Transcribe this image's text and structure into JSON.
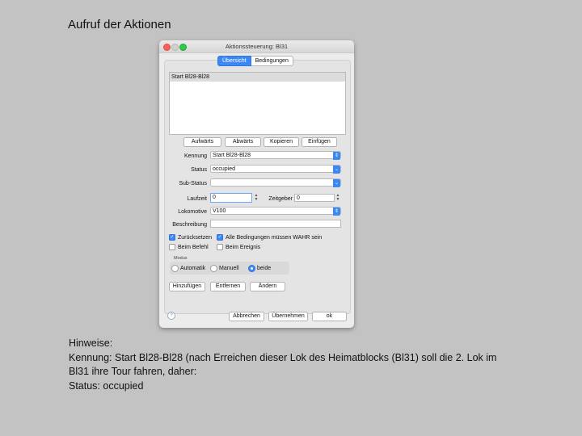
{
  "slide": {
    "title": "Aufruf der Aktionen",
    "notes": [
      "Hinweise:",
      "Kennung: Start Bl28-Bl28 (nach Erreichen dieser Lok des Heimatblocks (Bl31) soll die 2. Lok im",
      "Bl31 ihre Tour fahren, daher:",
      "Status: occupied"
    ]
  },
  "window": {
    "title": "Aktionssteuerung: Bl31",
    "tabs": [
      "Übersicht",
      "Bedingungen"
    ],
    "list": [
      "Start Bl28-Bl28"
    ],
    "list_buttons": [
      "Aufwärts",
      "Abwärts",
      "Kopieren",
      "Einfügen"
    ],
    "form": {
      "kennung_label": "Kennung",
      "kennung_value": "Start Bl28-Bl28",
      "status_label": "Status",
      "status_value": "occupied",
      "substatus_label": "Sub-Status",
      "substatus_value": "",
      "laufzeit_label": "Laufzeit",
      "laufzeit_value": "0",
      "zeitgeber_label": "Zeitgeber",
      "zeitgeber_value": "0",
      "lokomotive_label": "Lokomotive",
      "lokomotive_value": "V100",
      "beschreibung_label": "Beschreibung",
      "beschreibung_value": ""
    },
    "checkboxes": {
      "zuruecksetzen": "Zurücksetzen",
      "alle_bedingungen": "Alle Bedingungen müssen WAHR sein",
      "beim_befehl": "Beim Befehl",
      "beim_ereignis": "Beim Ereignis"
    },
    "modus": {
      "label": "Modus",
      "options": [
        "Automatik",
        "Manuell",
        "beide"
      ],
      "selected": "beide"
    },
    "action_buttons": [
      "Hinzufügen",
      "Entfernen",
      "Ändern"
    ],
    "help": "?",
    "footer_buttons": [
      "Abbrechen",
      "Übernehmen",
      "ok"
    ],
    "accent_color": "#3b88f5"
  }
}
